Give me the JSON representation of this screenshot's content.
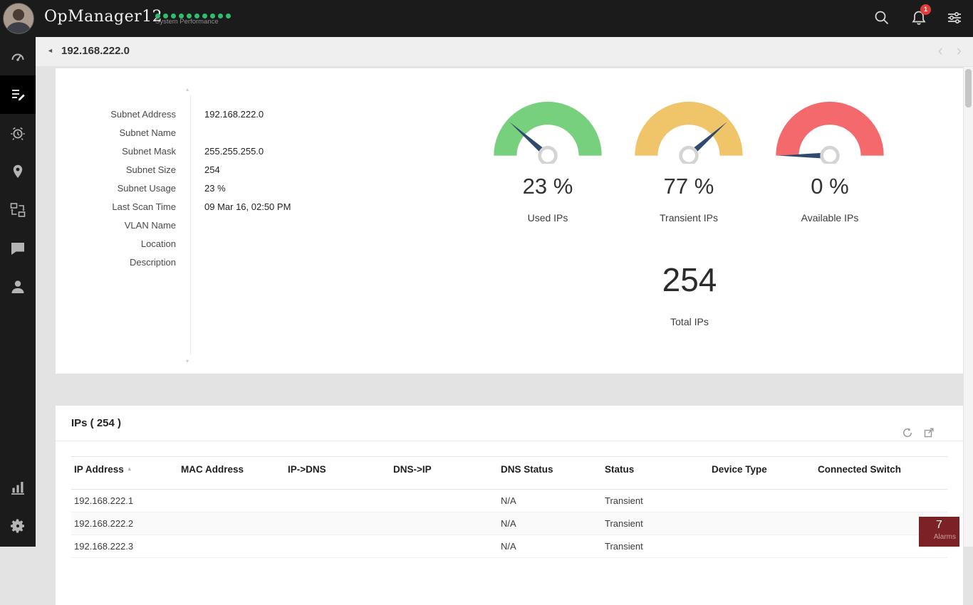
{
  "colors": {
    "topbar_bg": "#1b1b1b",
    "status_dot_green": "#2fbe6e",
    "notification_badge": "#e03c3c",
    "gauge_green": "#77d07e",
    "gauge_yellow": "#f0c468",
    "gauge_red": "#f4696b",
    "needle": "#2f4a6e",
    "alarm_badge_bg": "#7d2224"
  },
  "topbar": {
    "title": "OpManager12",
    "status_dots_count": 10,
    "status_label": "System Performance",
    "notification_count": "1"
  },
  "sidebar": {
    "icons": [
      {
        "name": "dashboard-gauge-icon",
        "active": false
      },
      {
        "name": "inventory-list-icon",
        "active": true
      },
      {
        "name": "alarms-clock-icon",
        "active": false
      },
      {
        "name": "location-pin-icon",
        "active": false
      },
      {
        "name": "virtualization-icon",
        "active": false
      },
      {
        "name": "chat-bubble-icon",
        "active": false
      },
      {
        "name": "user-icon",
        "active": false
      },
      {
        "name": "reports-chart-icon",
        "active": false
      },
      {
        "name": "settings-gear-icon",
        "active": false
      }
    ]
  },
  "breadcrumb": {
    "back_icon": "◄",
    "current": "192.168.222.0",
    "prev_icon": "‹",
    "next_icon": "›"
  },
  "subnet_details": {
    "fields": [
      {
        "label": "Subnet Address",
        "value": "192.168.222.0"
      },
      {
        "label": "Subnet Name",
        "value": ""
      },
      {
        "label": "Subnet Mask",
        "value": "255.255.255.0"
      },
      {
        "label": "Subnet Size",
        "value": "254"
      },
      {
        "label": "Subnet Usage",
        "value": "23 %"
      },
      {
        "label": "Last Scan Time",
        "value": "09 Mar 16, 02:50 PM"
      },
      {
        "label": "VLAN Name",
        "value": ""
      },
      {
        "label": "Location",
        "value": ""
      },
      {
        "label": "Description",
        "value": ""
      }
    ]
  },
  "chart_data": {
    "type": "gauge",
    "range": [
      0,
      100
    ],
    "series": [
      {
        "name": "Used IPs",
        "value": 23,
        "display": "23 %",
        "color": "#77d07e"
      },
      {
        "name": "Transient IPs",
        "value": 77,
        "display": "77 %",
        "color": "#f0c468"
      },
      {
        "name": "Available IPs",
        "value": 0,
        "display": "0 %",
        "color": "#f4696b"
      }
    ],
    "total": {
      "value": "254",
      "label": "Total IPs"
    }
  },
  "ips_panel": {
    "title": "IPs ( 254 )",
    "sort_icon": "▴",
    "columns": [
      {
        "label": "IP Address",
        "sortable": true
      },
      {
        "label": "MAC Address"
      },
      {
        "label": "IP->DNS"
      },
      {
        "label": "DNS->IP"
      },
      {
        "label": "DNS Status"
      },
      {
        "label": "Status"
      },
      {
        "label": "Device Type"
      },
      {
        "label": "Connected Switch"
      }
    ],
    "rows": [
      [
        "192.168.222.1",
        "",
        "",
        "",
        "N/A",
        "Transient",
        "",
        ""
      ],
      [
        "192.168.222.2",
        "",
        "",
        "",
        "N/A",
        "Transient",
        "",
        ""
      ],
      [
        "192.168.222.3",
        "",
        "",
        "",
        "N/A",
        "Transient",
        "",
        ""
      ]
    ]
  },
  "alarms": {
    "count": "7",
    "label": "Alarms"
  }
}
